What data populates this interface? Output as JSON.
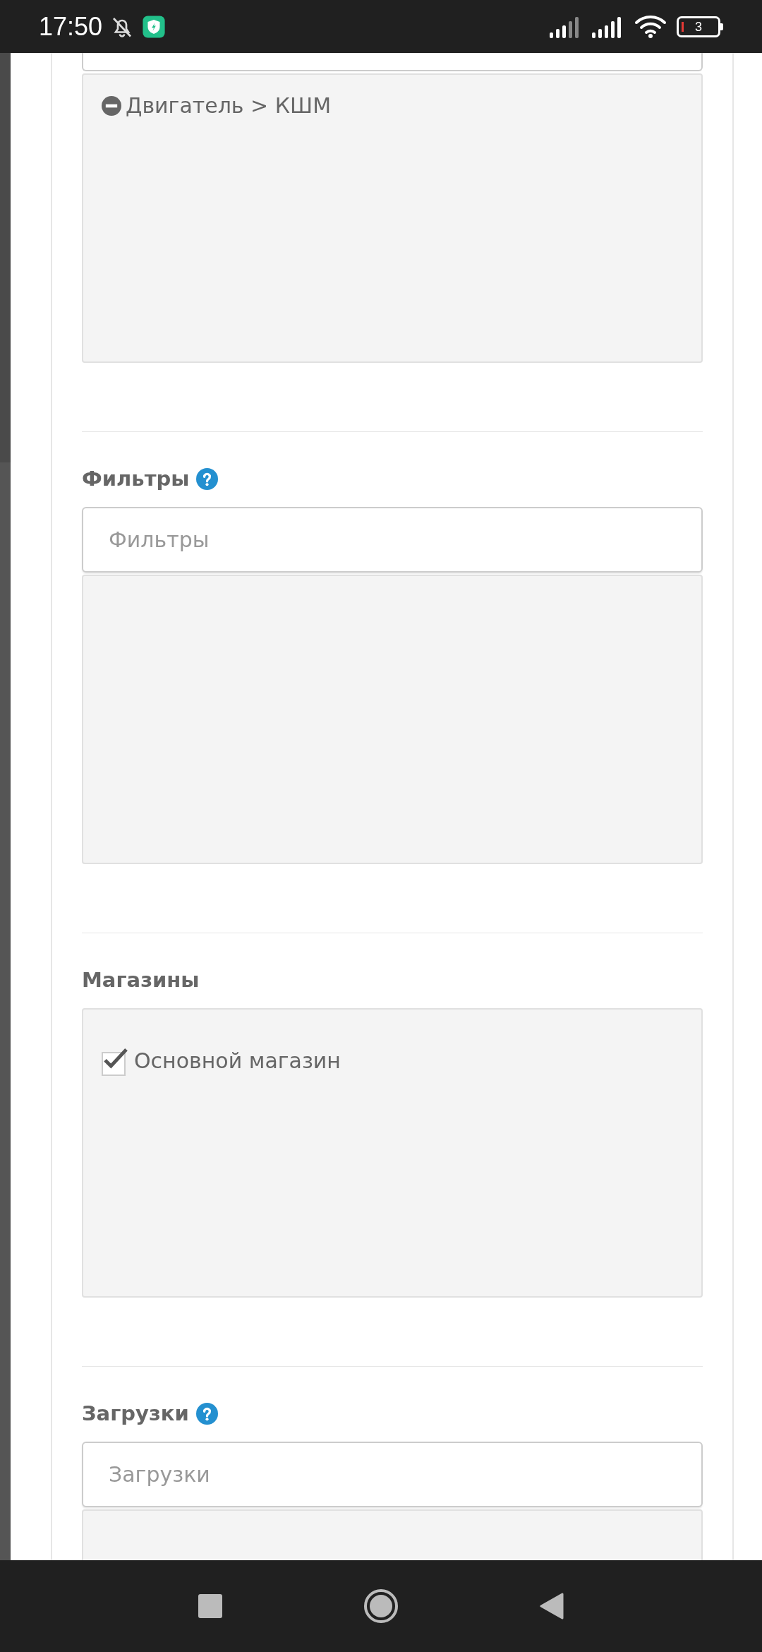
{
  "status_bar": {
    "time": "17:50",
    "battery": "3"
  },
  "sections": [
    {
      "kind": "category",
      "items": [
        {
          "text": "Двигатель > КШМ"
        }
      ]
    },
    {
      "kind": "autocomplete",
      "label": "Фильтры",
      "help": true,
      "placeholder": "Фильтры"
    },
    {
      "kind": "checklist",
      "label": "Магазины",
      "help": false,
      "items": [
        {
          "text": "Основной магазин",
          "checked": true
        }
      ]
    },
    {
      "kind": "autocomplete",
      "label": "Загрузки",
      "help": true,
      "placeholder": "Загрузки"
    }
  ]
}
